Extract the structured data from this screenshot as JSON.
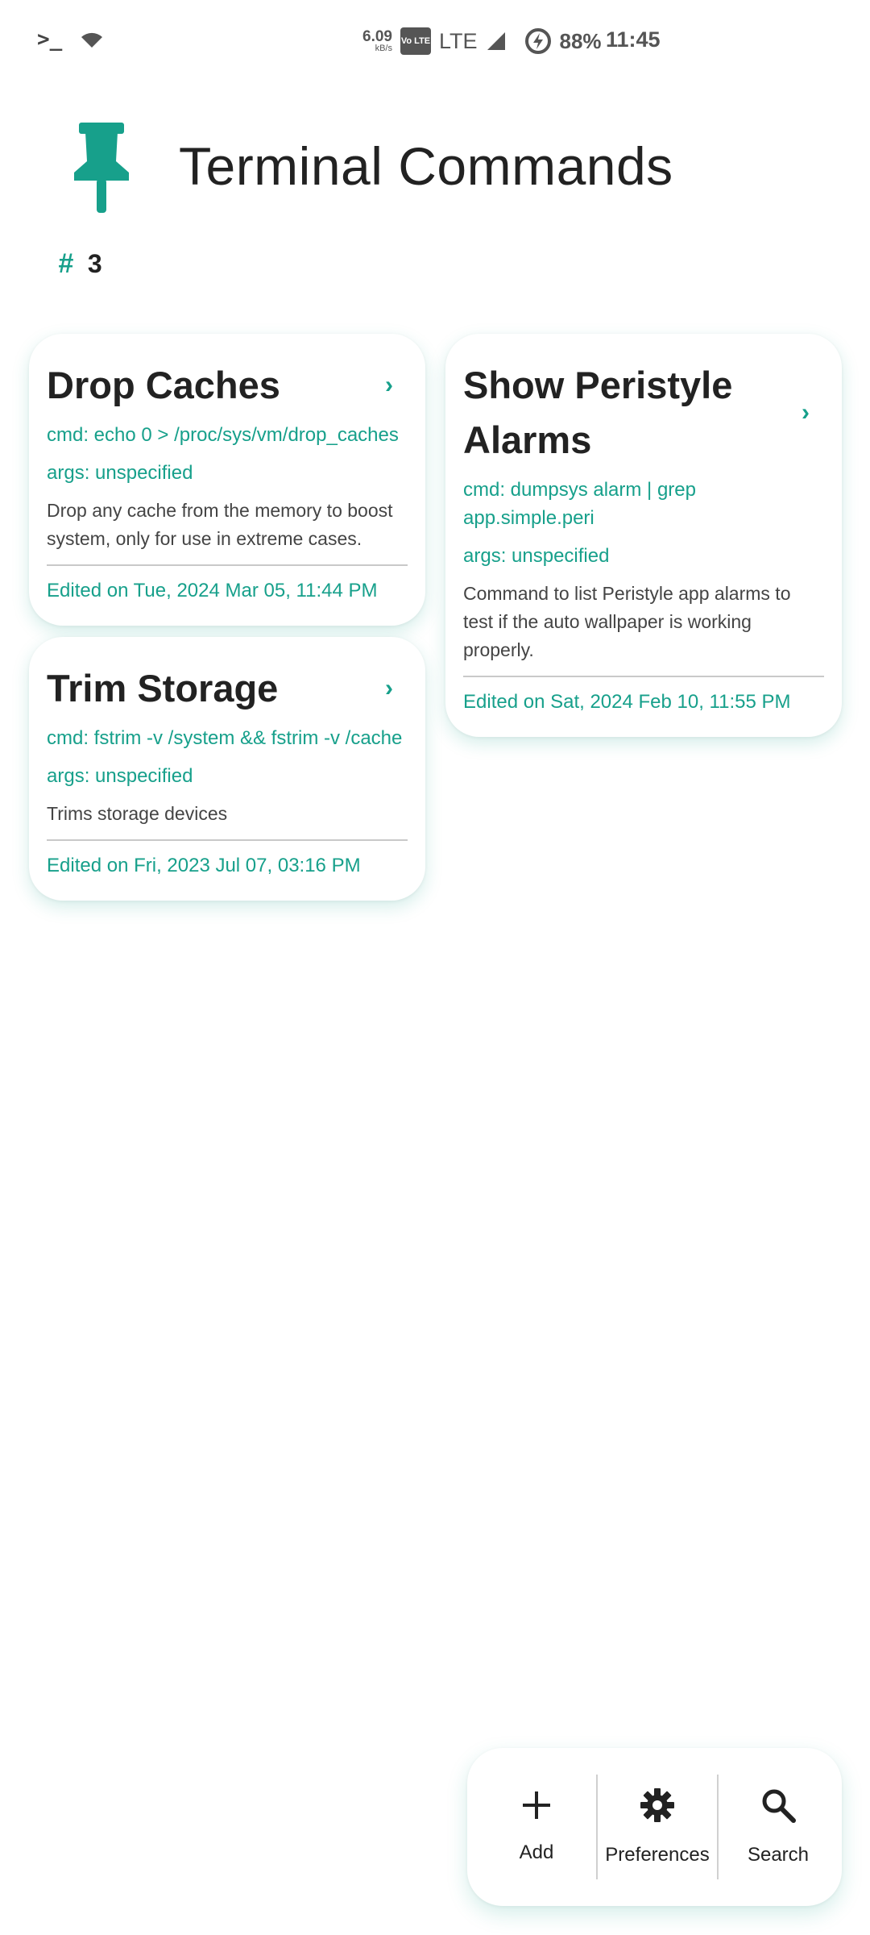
{
  "status_bar": {
    "net_speed": "6.09",
    "net_unit": "kB/s",
    "volte": "Vo LTE",
    "network": "LTE",
    "battery": "88%",
    "time": "11:45"
  },
  "header": {
    "title": "Terminal Commands"
  },
  "count": {
    "symbol": "#",
    "value": "3"
  },
  "cards": [
    {
      "title": "Drop Caches",
      "cmd": "cmd: echo 0 > /proc/sys/vm/drop_caches",
      "args": "args: unspecified",
      "description": "Drop any cache from the memory to boost system, only for use in extreme cases.",
      "edited": "Edited on Tue, 2024 Mar 05, 11:44 PM"
    },
    {
      "title": "Show Peristyle Alarms",
      "cmd": "cmd: dumpsys alarm | grep app.simple.peri",
      "args": "args: unspecified",
      "description": "Command to list Peristyle app alarms to test if the auto wallpaper is working properly.",
      "edited": "Edited on Sat, 2024 Feb 10, 11:55 PM"
    },
    {
      "title": "Trim Storage",
      "cmd": "cmd: fstrim -v /system && fstrim -v /cache",
      "args": "args: unspecified",
      "description": "Trims storage devices",
      "edited": "Edited on Fri, 2023 Jul 07, 03:16 PM"
    }
  ],
  "bottom_bar": {
    "add_label": "Add",
    "preferences_label": "Preferences",
    "search_label": "Search"
  },
  "colors": {
    "accent": "#17a08b",
    "text": "#222222"
  }
}
